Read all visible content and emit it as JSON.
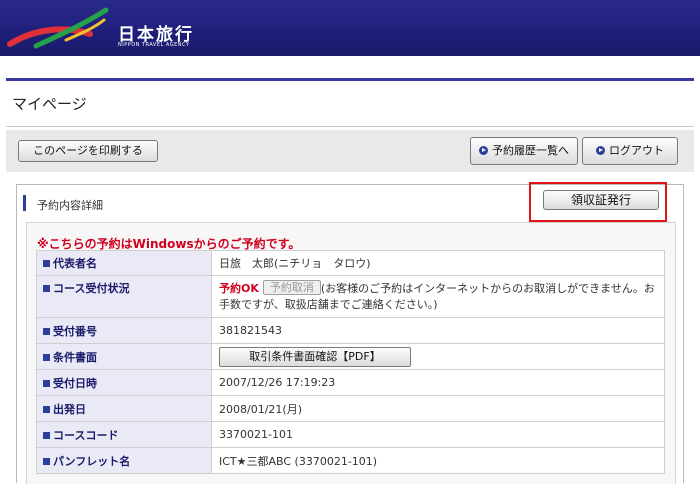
{
  "header": {
    "logo_text": "日本旅行",
    "logo_sub": "NIPPON TRAVEL AGENCY",
    "bg_color": "#1f1f7a"
  },
  "page_title": "マイページ",
  "toolbar": {
    "print_label": "このページを印刷する",
    "history_label": "予約履歴一覧へ",
    "logout_label": "ログアウト"
  },
  "panel": {
    "title": "予約内容詳細",
    "receipt_label": "領収証発行",
    "notice": "※こちらの予約はWindowsからのご予約です。",
    "rows": [
      {
        "label": "代表者名",
        "value": "日旅　太郎(ニチリョ　タロウ)"
      },
      {
        "label": "コース受付状況",
        "status": "予約OK",
        "cancel_label": "予約取消",
        "value": "(お客様のご予約はインターネットからのお取消しができません。お手数ですが、取扱店舗までご連絡ください。)"
      },
      {
        "label": "受付番号",
        "value": "381821543"
      },
      {
        "label": "条件書面",
        "button_label": "取引条件書面確認【PDF】"
      },
      {
        "label": "受付日時",
        "value": "2007/12/26 17:19:23"
      },
      {
        "label": "出発日",
        "value": "2008/01/21(月)"
      },
      {
        "label": "コースコード",
        "value": "3370021-101"
      },
      {
        "label": "パンフレット名",
        "value": "ICT★三都ABC (3370021-101)"
      }
    ]
  },
  "colors": {
    "accent": "#2b3e9a",
    "alert": "#d1001f",
    "highlight_outline": "#e01414"
  }
}
